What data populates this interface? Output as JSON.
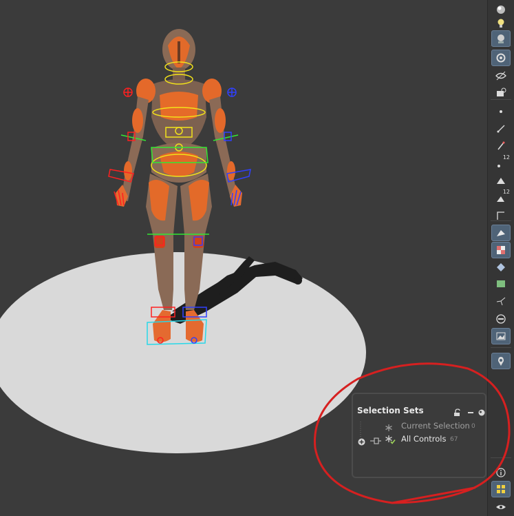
{
  "app": {
    "colors": {
      "viewport_bg": "#3b3b3b",
      "ground_disc": "#d8d8d8",
      "toolbar_bg": "#353535",
      "active_button": "#4f6377",
      "annotation": "#d62020",
      "accent_green": "#9fd45a"
    }
  },
  "toolbar": {
    "items": [
      {
        "icon": "lighting-sphere-icon"
      },
      {
        "icon": "light-bulb-icon"
      },
      {
        "icon": "headlight-icon",
        "active": true
      },
      {
        "icon": "camera-settings-icon",
        "active": true
      },
      {
        "icon": "visibility-eye-icon"
      },
      {
        "icon": "camera-lock-icon"
      },
      {
        "icon": "point-display-icon"
      },
      {
        "icon": "curve-display-icon"
      },
      {
        "icon": "pen-display-icon"
      },
      {
        "icon": "point-numbers-icon",
        "badge": "12"
      },
      {
        "icon": "primitive-display-icon"
      },
      {
        "icon": "primitive-numbers-icon",
        "badge": "12"
      },
      {
        "icon": "normals-icon"
      },
      {
        "icon": "shaded-mode-icon",
        "active": true
      },
      {
        "icon": "checker-texture-icon",
        "active": true
      },
      {
        "icon": "smooth-shading-icon"
      },
      {
        "icon": "uv-layout-icon"
      },
      {
        "icon": "transform-handle-icon"
      },
      {
        "icon": "grid-icon"
      },
      {
        "icon": "background-image-icon",
        "active": true
      },
      {
        "icon": "reference-pin-icon",
        "active": true
      },
      {
        "icon": "info-icon"
      },
      {
        "icon": "layout-grid-icon",
        "active": true
      },
      {
        "icon": "display-eye-icon"
      }
    ]
  },
  "selection_sets": {
    "title": "Selection Sets",
    "header_icons": [
      "lock-open-icon",
      "collapse-minus-icon",
      "options-icon"
    ],
    "rows": [
      {
        "label": "Current Selection",
        "count": "0",
        "icon": "asterisk-icon",
        "enabled": false
      },
      {
        "label": "All Controls",
        "count": "67",
        "icon": "asterisk-check-icon",
        "enabled": true
      }
    ]
  }
}
